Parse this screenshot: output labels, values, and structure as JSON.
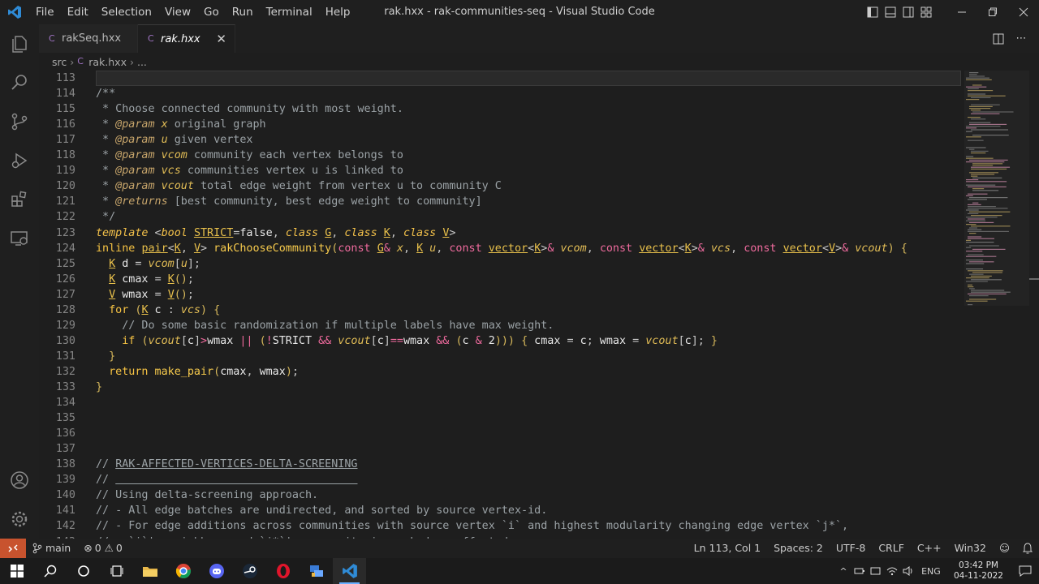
{
  "titlebar": {
    "menu": [
      "File",
      "Edit",
      "Selection",
      "View",
      "Go",
      "Run",
      "Terminal",
      "Help"
    ],
    "title": "rak.hxx - rak-communities-seq - Visual Studio Code"
  },
  "tabs": [
    {
      "label": "rakSeq.hxx",
      "active": false
    },
    {
      "label": "rak.hxx",
      "active": true
    }
  ],
  "breadcrumb": {
    "folder": "src",
    "file": "rak.hxx",
    "more": "..."
  },
  "editor": {
    "lines": [
      {
        "n": "113",
        "html": ""
      },
      {
        "n": "114",
        "html": "<span class='t-cm'>/**</span>"
      },
      {
        "n": "115",
        "html": "<span class='t-cm'> * Choose connected community with most weight.</span>"
      },
      {
        "n": "116",
        "html": "<span class='t-cm'> * </span><span class='t-doc'>@param</span><span class='t-pr'> x</span><span class='t-cm'> original graph</span>"
      },
      {
        "n": "117",
        "html": "<span class='t-cm'> * </span><span class='t-doc'>@param</span><span class='t-pr'> u</span><span class='t-cm'> given vertex</span>"
      },
      {
        "n": "118",
        "html": "<span class='t-cm'> * </span><span class='t-doc'>@param</span><span class='t-pr'> vcom</span><span class='t-cm'> community each vertex belongs to</span>"
      },
      {
        "n": "119",
        "html": "<span class='t-cm'> * </span><span class='t-doc'>@param</span><span class='t-pr'> vcs</span><span class='t-cm'> communities vertex u is linked to</span>"
      },
      {
        "n": "120",
        "html": "<span class='t-cm'> * </span><span class='t-doc'>@param</span><span class='t-pr'> vcout</span><span class='t-cm'> total edge weight from vertex u to community C</span>"
      },
      {
        "n": "121",
        "html": "<span class='t-cm'> * </span><span class='t-doc'>@returns</span><span class='t-cm'> [best community, best edge weight to community]</span>"
      },
      {
        "n": "122",
        "html": "<span class='t-cm'> */</span>"
      },
      {
        "n": "123",
        "html": "<span class='t-kw'>template</span><span class='t-op'> &lt;</span><span class='t-kw'>bool</span> <span class='t-tp'>STRICT</span><span class='t-op'>=</span><span class='t-wh'>false</span><span class='t-op'>, </span><span class='t-kw'>class</span> <span class='t-tp'>G</span><span class='t-op'>, </span><span class='t-kw'>class</span> <span class='t-tp'>K</span><span class='t-op'>, </span><span class='t-kw'>class</span> <span class='t-tp'>V</span><span class='t-op'>&gt;</span>"
      },
      {
        "n": "124",
        "html": "<span class='t-kw2'>inline</span> <span class='t-tp'>pair</span><span class='t-op'>&lt;</span><span class='t-tp'>K</span><span class='t-op'>, </span><span class='t-tp'>V</span><span class='t-op'>&gt; </span><span class='t-fn'>rakChooseCommunity</span><span class='t-br'>(</span><span class='t-pk'>const</span> <span class='t-tp'>G</span><span class='t-pk'>&amp;</span><span class='t-pr'> x</span><span class='t-op'>, </span><span class='t-tp'>K</span><span class='t-pr'> u</span><span class='t-op'>, </span><span class='t-pk'>const</span> <span class='t-tp'>vector</span><span class='t-op'>&lt;</span><span class='t-tp'>K</span><span class='t-op'>&gt;</span><span class='t-pk'>&amp;</span><span class='t-pr'> vcom</span><span class='t-op'>, </span><span class='t-pk'>const</span> <span class='t-tp'>vector</span><span class='t-op'>&lt;</span><span class='t-tp'>K</span><span class='t-op'>&gt;</span><span class='t-pk'>&amp;</span><span class='t-pr'> vcs</span><span class='t-op'>, </span><span class='t-pk'>const</span> <span class='t-tp'>vector</span><span class='t-op'>&lt;</span><span class='t-tp'>V</span><span class='t-op'>&gt;</span><span class='t-pk'>&amp;</span><span class='t-pr'> vcout</span><span class='t-br'>)</span><span class='t-op'> </span><span class='t-br'>{</span>"
      },
      {
        "n": "125",
        "html": "  <span class='t-tp'>K</span><span class='t-wh'> d </span><span class='t-op'>=</span><span class='t-pr'> vcom</span><span class='t-op'>[</span><span class='t-pr'>u</span><span class='t-op'>];</span>"
      },
      {
        "n": "126",
        "html": "  <span class='t-tp'>K</span><span class='t-wh'> cmax </span><span class='t-op'>=</span> <span class='t-tp'>K</span><span class='t-br'>()</span><span class='t-op'>;</span>"
      },
      {
        "n": "127",
        "html": "  <span class='t-tp'>V</span><span class='t-wh'> wmax </span><span class='t-op'>=</span> <span class='t-tp'>V</span><span class='t-br'>()</span><span class='t-op'>;</span>"
      },
      {
        "n": "128",
        "html": "  <span class='t-kw2'>for</span><span class='t-op'> </span><span class='t-br'>(</span><span class='t-tp'>K</span><span class='t-wh'> c </span><span class='t-op'>:</span><span class='t-pr'> vcs</span><span class='t-br'>)</span><span class='t-op'> </span><span class='t-br'>{</span>"
      },
      {
        "n": "129",
        "html": "    <span class='t-cm'>// Do some basic randomization if multiple labels have max weight.</span>"
      },
      {
        "n": "130",
        "html": "    <span class='t-kw2'>if</span><span class='t-op'> </span><span class='t-br'>(</span><span class='t-pr'>vcout</span><span class='t-op'>[</span><span class='t-wh'>c</span><span class='t-op'>]</span><span class='t-pk'>&gt;</span><span class='t-wh'>wmax </span><span class='t-pk'>||</span><span class='t-op'> </span><span class='t-br'>(</span><span class='t-pk'>!</span><span class='t-wh'>STRICT </span><span class='t-pk'>&amp;&amp;</span><span class='t-pr'> vcout</span><span class='t-op'>[</span><span class='t-wh'>c</span><span class='t-op'>]</span><span class='t-pk'>==</span><span class='t-wh'>wmax </span><span class='t-pk'>&amp;&amp;</span><span class='t-op'> </span><span class='t-br'>(</span><span class='t-wh'>c </span><span class='t-pk'>&amp;</span><span class='t-wh'> 2</span><span class='t-br'>)))</span><span class='t-op'> </span><span class='t-br'>{</span><span class='t-wh'> cmax </span><span class='t-op'>=</span><span class='t-wh'> c</span><span class='t-op'>;</span><span class='t-wh'> wmax </span><span class='t-op'>=</span><span class='t-pr'> vcout</span><span class='t-op'>[</span><span class='t-wh'>c</span><span class='t-op'>];</span><span class='t-op'> </span><span class='t-br'>}</span>"
      },
      {
        "n": "131",
        "html": "  <span class='t-br'>}</span>"
      },
      {
        "n": "132",
        "html": "  <span class='t-kw2'>return</span><span class='t-fn'> make_pair</span><span class='t-br'>(</span><span class='t-wh'>cmax</span><span class='t-op'>, </span><span class='t-wh'>wmax</span><span class='t-br'>)</span><span class='t-op'>;</span>"
      },
      {
        "n": "133",
        "html": "<span class='t-br'>}</span>"
      },
      {
        "n": "134",
        "html": ""
      },
      {
        "n": "135",
        "html": ""
      },
      {
        "n": "136",
        "html": ""
      },
      {
        "n": "137",
        "html": ""
      },
      {
        "n": "138",
        "html": "<span class='t-cm'>// <u>RAK-AFFECTED-VERTICES-DELTA-SCREENING</u></span>"
      },
      {
        "n": "139",
        "html": "<span class='t-cm'>// <u>                                     </u></span>"
      },
      {
        "n": "140",
        "html": "<span class='t-cm'>// Using delta-screening approach.</span>"
      },
      {
        "n": "141",
        "html": "<span class='t-cm'>// - All edge batches are undirected, and sorted by source vertex-id.</span>"
      },
      {
        "n": "142",
        "html": "<span class='t-cm'>// - For edge additions across communities with source vertex `i` and highest modularity changing edge vertex `j*`,</span>"
      },
      {
        "n": "143",
        "html": "<span class='t-cm'>//   `i`'s neighbors and `j*`'s community is marked as affected.</span>"
      }
    ]
  },
  "statusbar": {
    "branch": "main",
    "errors": "0",
    "warnings": "0",
    "position": "Ln 113, Col 1",
    "spaces": "Spaces: 2",
    "encoding": "UTF-8",
    "eol": "CRLF",
    "language": "C++",
    "platform": "Win32"
  },
  "taskbar": {
    "lang": "ENG",
    "time": "03:42 PM",
    "date": "04-11-2022"
  },
  "colors": {
    "accent_remote": "#c8532e",
    "vscode_blue": "#2f8bd6"
  }
}
